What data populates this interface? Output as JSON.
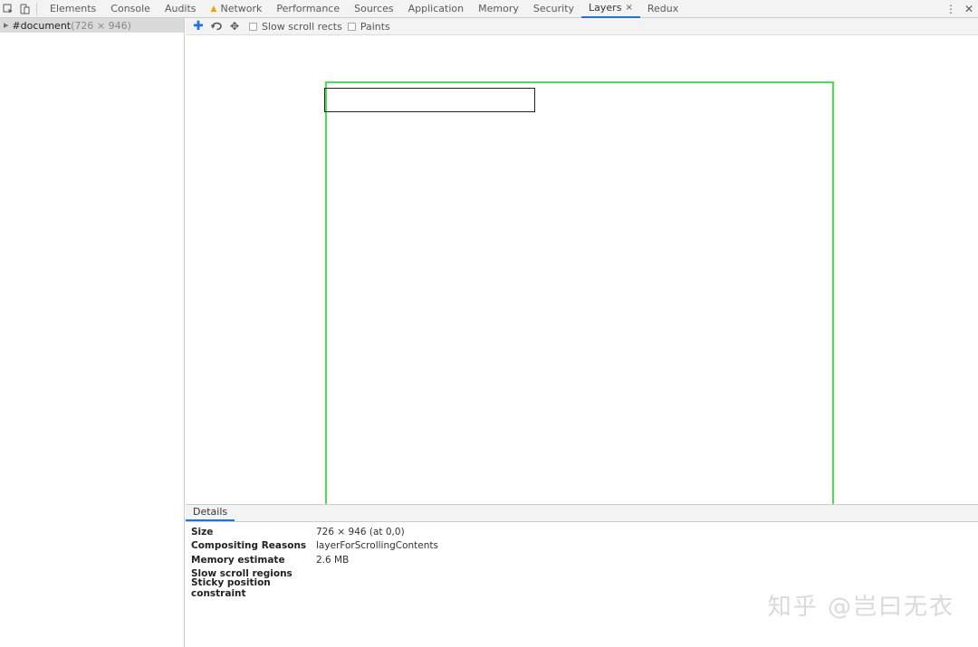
{
  "tabs": [
    {
      "label": "Elements",
      "active": false,
      "warning": false
    },
    {
      "label": "Console",
      "active": false,
      "warning": false
    },
    {
      "label": "Audits",
      "active": false,
      "warning": false
    },
    {
      "label": "Network",
      "active": false,
      "warning": true
    },
    {
      "label": "Performance",
      "active": false,
      "warning": false
    },
    {
      "label": "Sources",
      "active": false,
      "warning": false
    },
    {
      "label": "Application",
      "active": false,
      "warning": false
    },
    {
      "label": "Memory",
      "active": false,
      "warning": false
    },
    {
      "label": "Security",
      "active": false,
      "warning": false
    },
    {
      "label": "Layers",
      "active": true,
      "warning": false,
      "closable": true
    },
    {
      "label": "Redux",
      "active": false,
      "warning": false
    }
  ],
  "tree": {
    "root_name": "#document",
    "root_dims": "(726 × 946)"
  },
  "layers_toolbar": {
    "slow_scroll_rects_label": "Slow scroll rects",
    "paints_label": "Paints"
  },
  "details": {
    "tab_label": "Details",
    "rows": [
      {
        "key": "Size",
        "value": "726 × 946 (at 0,0)"
      },
      {
        "key": "Compositing Reasons",
        "value": "layerForScrollingContents"
      },
      {
        "key": "Memory estimate",
        "value": "2.6 MB"
      },
      {
        "key": "Slow scroll regions",
        "value": ""
      },
      {
        "key": "Sticky position constraint",
        "value": ""
      }
    ]
  },
  "watermark": "知乎 @岂曰无衣",
  "colors": {
    "accent": "#1a73e8",
    "layer_border": "#4fdc4f",
    "warning": "#e8a600"
  }
}
